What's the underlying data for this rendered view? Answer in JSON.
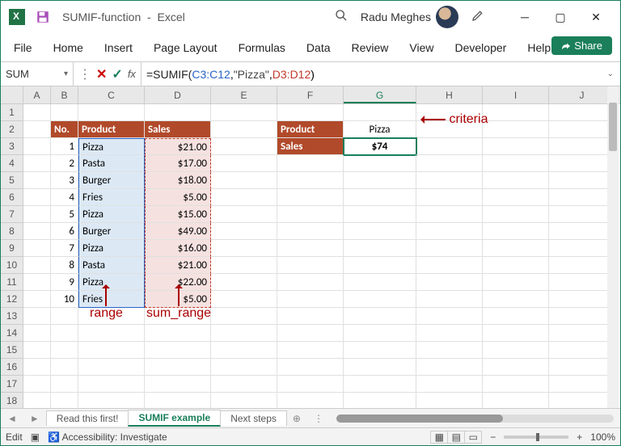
{
  "titlebar": {
    "filename": "SUMIF-function",
    "app": "Excel",
    "user": "Radu Meghes"
  },
  "ribbon": {
    "tabs": [
      "File",
      "Home",
      "Insert",
      "Page Layout",
      "Formulas",
      "Data",
      "Review",
      "View",
      "Developer",
      "Help"
    ],
    "share": "Share"
  },
  "namebox": "SUM",
  "formula": {
    "eq": "=",
    "fn": "SUMIF(",
    "ref1": "C3:C12",
    "c1": ", ",
    "txt": "\"Pizza\"",
    "c2": ", ",
    "ref2": "D3:D12",
    "close": ")"
  },
  "columns": [
    "A",
    "B",
    "C",
    "D",
    "E",
    "F",
    "G",
    "H",
    "I",
    "J"
  ],
  "t1": {
    "h_no": "No.",
    "h_prod": "Product",
    "h_sales": "Sales",
    "rows": [
      {
        "n": "1",
        "p": "Pizza",
        "s": "$21.00"
      },
      {
        "n": "2",
        "p": "Pasta",
        "s": "$17.00"
      },
      {
        "n": "3",
        "p": "Burger",
        "s": "$18.00"
      },
      {
        "n": "4",
        "p": "Fries",
        "s": "$5.00"
      },
      {
        "n": "5",
        "p": "Pizza",
        "s": "$15.00"
      },
      {
        "n": "6",
        "p": "Burger",
        "s": "$49.00"
      },
      {
        "n": "7",
        "p": "Pizza",
        "s": "$16.00"
      },
      {
        "n": "8",
        "p": "Pasta",
        "s": "$21.00"
      },
      {
        "n": "9",
        "p": "Pizza",
        "s": "$22.00"
      },
      {
        "n": "10",
        "p": "Fries",
        "s": "$5.00"
      }
    ]
  },
  "t2": {
    "h_prod": "Product",
    "v_prod": "Pizza",
    "h_sales": "Sales",
    "v_sales": "$74"
  },
  "anno": {
    "criteria": "criteria",
    "range": "range",
    "sum_range": "sum_range"
  },
  "sheets": {
    "s1": "Read this first!",
    "s2": "SUMIF example",
    "s3": "Next steps"
  },
  "status": {
    "mode": "Edit",
    "acc": "Accessibility: Investigate",
    "zoom": "100%"
  },
  "chart_data": {
    "type": "table",
    "title": "SUMIF example",
    "columns": [
      "No.",
      "Product",
      "Sales"
    ],
    "rows": [
      [
        1,
        "Pizza",
        21.0
      ],
      [
        2,
        "Pasta",
        17.0
      ],
      [
        3,
        "Burger",
        18.0
      ],
      [
        4,
        "Fries",
        5.0
      ],
      [
        5,
        "Pizza",
        15.0
      ],
      [
        6,
        "Burger",
        49.0
      ],
      [
        7,
        "Pizza",
        16.0
      ],
      [
        8,
        "Pasta",
        21.0
      ],
      [
        9,
        "Pizza",
        22.0
      ],
      [
        10,
        "Fries",
        5.0
      ]
    ],
    "summary": {
      "criteria_label": "Product",
      "criteria_value": "Pizza",
      "result_label": "Sales",
      "result_value": 74
    },
    "formula": "=SUMIF(C3:C12, \"Pizza\", D3:D12)"
  }
}
